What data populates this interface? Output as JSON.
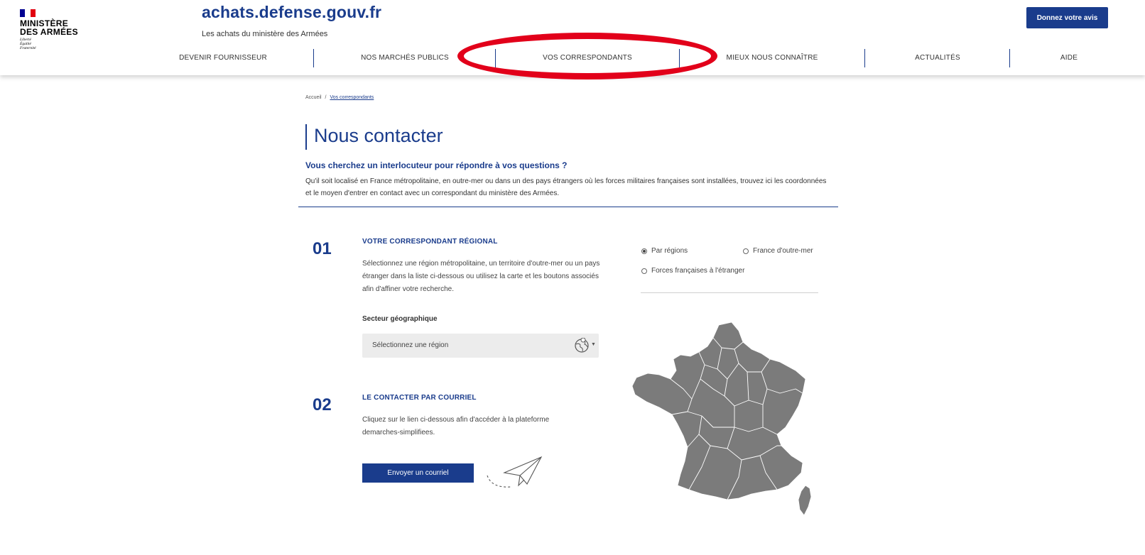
{
  "header": {
    "ministry_line1": "MINISTÈRE",
    "ministry_line2": "DES ARMÉES",
    "motto": [
      "Liberté",
      "Égalité",
      "Fraternité"
    ],
    "site_title": "achats.defense.gouv.fr",
    "site_subtitle": "Les achats du ministère des Armées",
    "feedback_button": "Donnez votre avis"
  },
  "nav": {
    "items": [
      "DEVENIR FOURNISSEUR",
      "NOS MARCHÉS PUBLICS",
      "VOS CORRESPONDANTS",
      "MIEUX NOUS CONNAÎTRE",
      "ACTUALITÉS",
      "AIDE"
    ],
    "highlighted": "VOS CORRESPONDANTS"
  },
  "breadcrumb": {
    "home": "Accueil",
    "separator": "/",
    "current": "Vos correspondants"
  },
  "page": {
    "title": "Nous contacter",
    "lead_question": "Vous cherchez un interlocuteur pour répondre à vos questions ?",
    "lead_text": "Qu'il soit localisé en France métropolitaine, en outre-mer ou dans un des pays étrangers où les forces militaires françaises sont installées, trouvez ici les coordonnées et le moyen d'entrer en contact avec un correspondant du ministère des Armées."
  },
  "step1": {
    "number": "01",
    "title": "VOTRE CORRESPONDANT RÉGIONAL",
    "text": "Sélectionnez une région métropolitaine, un territoire d'outre-mer ou un pays étranger dans la liste ci-dessous ou utilisez la carte et les boutons associés afin d'affiner votre recherche.",
    "select_label": "Secteur géographique",
    "select_placeholder": "Sélectionnez une région"
  },
  "step2": {
    "number": "02",
    "title": "LE CONTACTER PAR COURRIEL",
    "text": "Cliquez sur le lien ci-dessous afin d'accéder à la plateforme demarches-simplifiees.",
    "button": "Envoyer un courriel"
  },
  "filters": {
    "options": [
      "Par régions",
      "France d'outre-mer",
      "Forces françaises à l'étranger"
    ],
    "selected": "Par régions"
  },
  "colors": {
    "primary": "#1a3c8c",
    "highlight": "#e2001a",
    "map": "#7b7b7b"
  },
  "icons": {
    "select": "globe-pin-icon",
    "decoration": "paper-plane-icon"
  }
}
